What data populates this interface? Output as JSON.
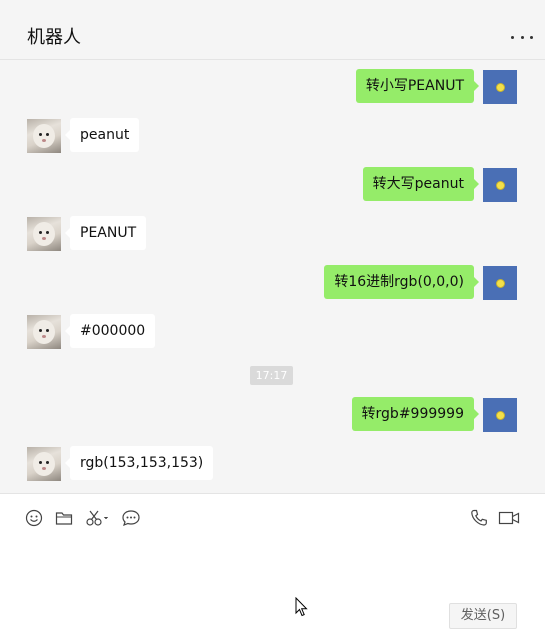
{
  "window": {
    "pin_glyph": "〒"
  },
  "header": {
    "title": "机器人"
  },
  "messages": [
    {
      "side": "right",
      "text": "转小写PEANUT"
    },
    {
      "side": "left",
      "text": "peanut"
    },
    {
      "side": "right",
      "text": "转大写peanut"
    },
    {
      "side": "left",
      "text": "PEANUT"
    },
    {
      "side": "right",
      "text": "转16进制rgb(0,0,0)"
    },
    {
      "side": "left",
      "text": "#000000"
    },
    {
      "side": "time",
      "text": "17:17"
    },
    {
      "side": "right",
      "text": "转rgb#999999"
    },
    {
      "side": "left",
      "text": "rgb(153,153,153)"
    }
  ],
  "toolbar": {
    "icons": [
      "emoji-icon",
      "folder-icon",
      "scissors-icon",
      "chat-bubble-icon",
      "phone-icon",
      "video-icon"
    ]
  },
  "input": {
    "send_label": "发送(S)"
  },
  "colors": {
    "bubble_out": "#95ec69",
    "bubble_in": "#ffffff",
    "background": "#f5f5f5"
  }
}
